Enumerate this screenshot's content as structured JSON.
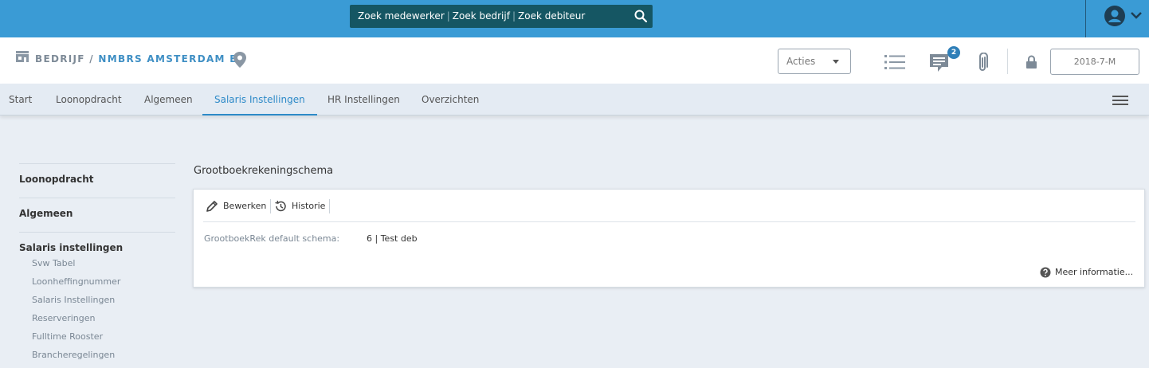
{
  "topbar": {
    "search_parts": [
      "Zoek medewerker",
      "Zoek bedrijf",
      "Zoek debiteur"
    ],
    "separator": "|"
  },
  "header": {
    "crumb_root": "BEDRIJF /",
    "crumb_company": "NMBRS AMSTERDAM BV",
    "actions_label": "Acties",
    "messages_badge": "2",
    "period": "2018-7-M"
  },
  "tabs": [
    "Start",
    "Loonopdracht",
    "Algemeen",
    "Salaris Instellingen",
    "HR Instellingen",
    "Overzichten"
  ],
  "active_tab": "Salaris Instellingen",
  "sidebar": {
    "sections": [
      "Loonopdracht",
      "Algemeen",
      "Salaris instellingen"
    ],
    "sub_items": [
      "Svw Tabel",
      "Loonheffingnummer",
      "Salaris Instellingen",
      "Reserveringen",
      "Fulltime Rooster",
      "Brancheregelingen"
    ]
  },
  "main": {
    "title": "Grootboekrekeningschema",
    "edit_label": "Bewerken",
    "history_label": "Historie",
    "field_label": "GrootboekRek default schema:",
    "field_value": "6 | Test deb",
    "more_info": "Meer informatie..."
  },
  "colors": {
    "topbar": "#3a9bd5",
    "search_bg": "#155663",
    "accent": "#2d8ac8",
    "page_bg": "#e9eef4"
  },
  "icons": [
    "search-icon",
    "user-avatar-icon",
    "chevron-down-icon",
    "building-icon",
    "location-pin-icon",
    "list-icon",
    "chat-icon",
    "paperclip-icon",
    "lock-icon",
    "hamburger-menu-icon",
    "pencil-icon",
    "history-icon",
    "help-circle-icon"
  ]
}
